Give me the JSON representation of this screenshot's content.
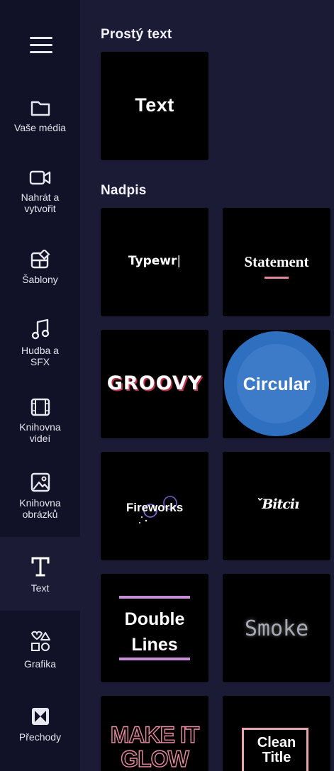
{
  "sidebar": {
    "items": [
      {
        "label": "Vaše média",
        "icon": "folder-icon"
      },
      {
        "label": "Nahrát a\nvytvořit",
        "icon": "video-camera-icon"
      },
      {
        "label": "Šablony",
        "icon": "templates-icon"
      },
      {
        "label": "Hudba a\nSFX",
        "icon": "music-note-icon"
      },
      {
        "label": "Knihovna\nvideí",
        "icon": "film-icon"
      },
      {
        "label": "Knihovna\nobrázků",
        "icon": "image-icon"
      },
      {
        "label": "Text",
        "icon": "text-icon"
      },
      {
        "label": "Grafika",
        "icon": "shapes-icon"
      },
      {
        "label": "Přechody",
        "icon": "transitions-icon"
      }
    ],
    "active_index": 6
  },
  "sections": {
    "plain": {
      "title": "Prostý text",
      "items": [
        {
          "label": "Text"
        }
      ]
    },
    "heading": {
      "title": "Nadpis",
      "items": [
        {
          "label": "Typewr"
        },
        {
          "label": "Statement"
        },
        {
          "label": "GROOVY"
        },
        {
          "label": "Circular"
        },
        {
          "label": "Fireworks"
        },
        {
          "label": "Bitcoin"
        },
        {
          "label": "Double Lines",
          "line1": "Double",
          "line2": "Lines"
        },
        {
          "label": "Smoke"
        },
        {
          "label": "MAKE IT GLOW",
          "line1": "MAKE IT",
          "line2": "GLOW"
        },
        {
          "label": "Clean Title",
          "line1": "Clean",
          "line2": "Title"
        }
      ]
    }
  },
  "colors": {
    "sidebar_bg": "#111127",
    "panel_bg": "#1b1b35",
    "tile_bg": "#000000",
    "accent_pink": "#e08aa0",
    "accent_purple": "#b07ad8",
    "circular_blue": "#2f6fc0"
  }
}
